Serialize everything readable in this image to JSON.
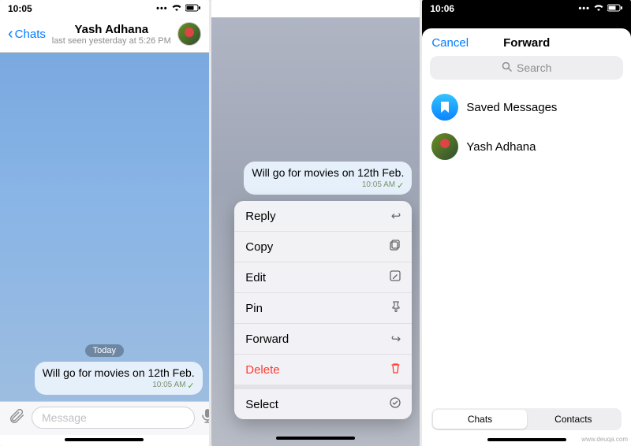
{
  "screen1": {
    "status": {
      "time": "10:05"
    },
    "header": {
      "back": "Chats",
      "name": "Yash Adhana",
      "sub": "last seen yesterday at 5:26 PM"
    },
    "date_pill": "Today",
    "message": {
      "text": "Will go for movies on 12th Feb.",
      "time": "10:05 AM"
    },
    "input_placeholder": "Message"
  },
  "screen2": {
    "message": {
      "text": "Will go for movies on 12th Feb.",
      "time": "10:05 AM"
    },
    "menu": {
      "reply": "Reply",
      "copy": "Copy",
      "edit": "Edit",
      "pin": "Pin",
      "forward": "Forward",
      "delete": "Delete",
      "select": "Select"
    }
  },
  "screen3": {
    "status": {
      "time": "10:06"
    },
    "cancel": "Cancel",
    "title": "Forward",
    "search_placeholder": "Search",
    "items": {
      "saved": "Saved Messages",
      "user": "Yash Adhana"
    },
    "segmented": {
      "chats": "Chats",
      "contacts": "Contacts"
    }
  },
  "watermark": "www.deuqa.com"
}
